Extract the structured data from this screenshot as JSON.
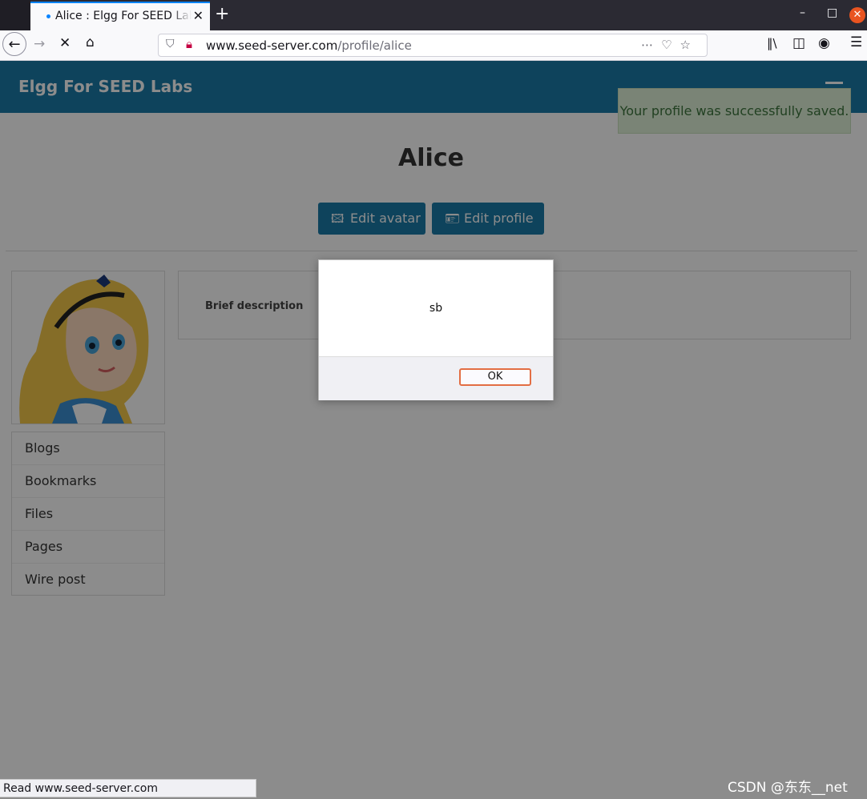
{
  "browser": {
    "tab_title": "Alice : Elgg For SEED Labs",
    "url_host": "www.seed-server.com",
    "url_path": "/profile/alice",
    "icons": [
      "back-arrow-icon",
      "forward-arrow-icon",
      "stop-loading-icon",
      "home-icon",
      "shield-icon",
      "insecure-connection-icon",
      "more-actions-icon",
      "pocket-icon",
      "bookmark-star-icon",
      "library-icon",
      "sidebar-icon",
      "account-icon",
      "menu-icon"
    ]
  },
  "site": {
    "title": "Elgg For SEED Labs",
    "flash_message": "Your profile was successfully saved."
  },
  "profile": {
    "name": "Alice",
    "edit_avatar_label": "Edit avatar",
    "edit_profile_label": "Edit profile",
    "brief_description_label": "Brief description"
  },
  "menu": {
    "items": [
      "Blogs",
      "Bookmarks",
      "Files",
      "Pages",
      "Wire post"
    ]
  },
  "alert": {
    "message": "sb",
    "ok_label": "OK"
  },
  "status": {
    "text": "Read www.seed-server.com"
  },
  "watermark": "CSDN @东东__net",
  "colors": {
    "elgg_blue": "#1b7aa8",
    "flash_bg": "#dff0d8",
    "flash_text": "#3c763d",
    "ok_focus_ring": "#e36e43"
  }
}
